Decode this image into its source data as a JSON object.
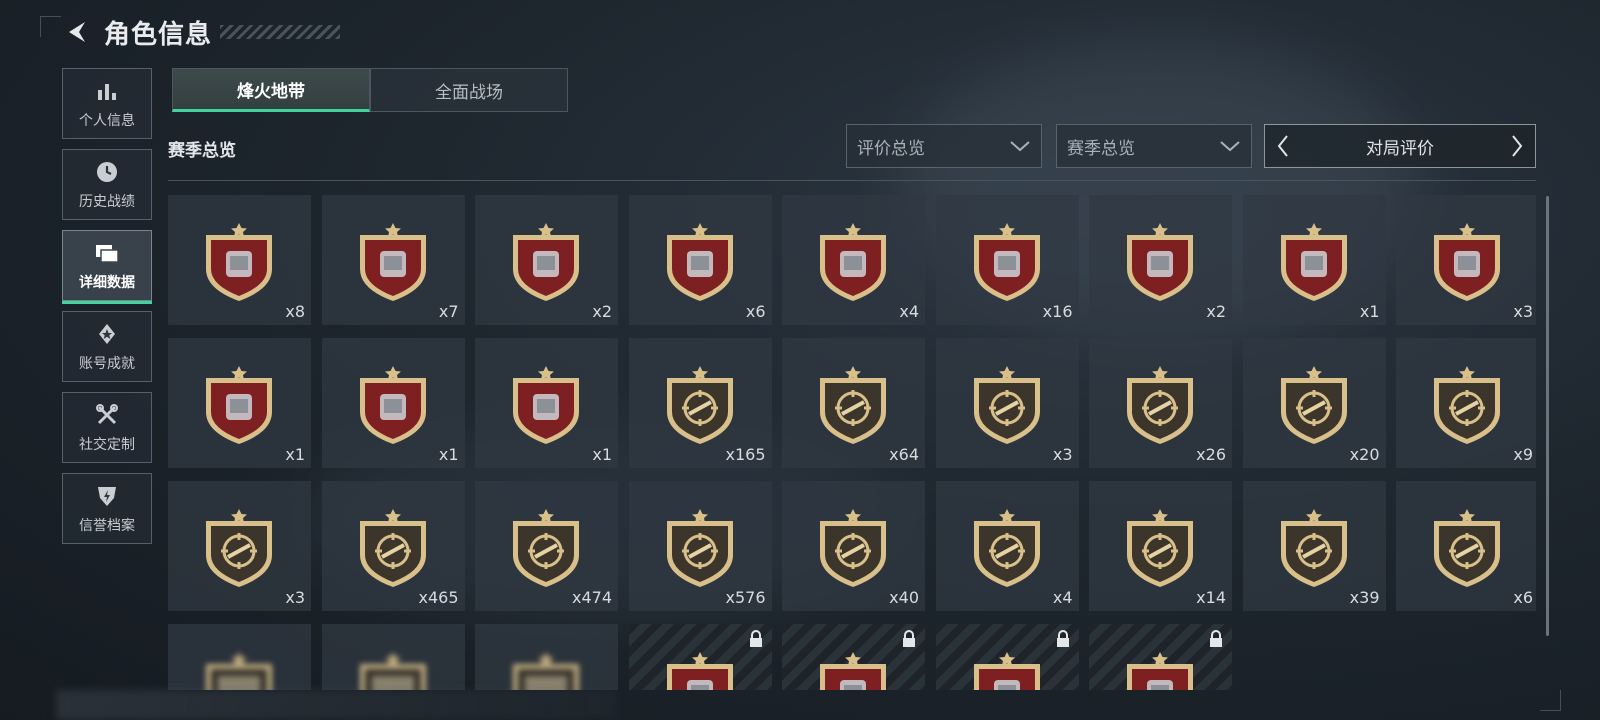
{
  "header": {
    "title": "角色信息",
    "back_icon": "back-arrow-icon"
  },
  "sidebar": {
    "items": [
      {
        "label": "个人信息",
        "icon": "bar-chart-icon",
        "active": false
      },
      {
        "label": "历史战绩",
        "icon": "clock-icon",
        "active": false
      },
      {
        "label": "详细数据",
        "icon": "folder-icon",
        "active": true
      },
      {
        "label": "账号成就",
        "icon": "medal-icon",
        "active": false
      },
      {
        "label": "社交定制",
        "icon": "tools-icon",
        "active": false
      },
      {
        "label": "信誉档案",
        "icon": "shield-bolt-icon",
        "active": false
      }
    ]
  },
  "tabs": [
    {
      "label": "烽火地带",
      "active": true
    },
    {
      "label": "全面战场",
      "active": false
    }
  ],
  "section": {
    "title": "赛季总览"
  },
  "filters": {
    "rating": {
      "label": "评价总览"
    },
    "season": {
      "label": "赛季总览"
    },
    "match": {
      "label": "对局评价"
    }
  },
  "colors": {
    "accent": "#43d39e",
    "gold": "#d9c08a",
    "red_shield": "#7e1f22"
  },
  "badges": [
    {
      "type": "red",
      "item": "diamond-icon",
      "count": "x8"
    },
    {
      "type": "red",
      "item": "tank-icon",
      "count": "x7"
    },
    {
      "type": "red",
      "item": "card-icon",
      "count": "x2"
    },
    {
      "type": "red",
      "item": "plate-icon",
      "count": "x6"
    },
    {
      "type": "red",
      "item": "server-rack-icon",
      "count": "x4"
    },
    {
      "type": "red",
      "item": "chip-icon",
      "count": "x16"
    },
    {
      "type": "red",
      "item": "machine-icon",
      "count": "x2"
    },
    {
      "type": "red",
      "item": "reactor-icon",
      "count": "x1"
    },
    {
      "type": "red",
      "item": "egg-icon",
      "count": "x3"
    },
    {
      "type": "red",
      "item": "chessboard-icon",
      "count": "x1"
    },
    {
      "type": "red",
      "item": "painting-icon",
      "count": "x1"
    },
    {
      "type": "red",
      "item": "crystal-icon",
      "count": "x1"
    },
    {
      "type": "gold",
      "item": "rifle-crosshair-icon",
      "count": "x165"
    },
    {
      "type": "gold",
      "item": "rifle-crosshair-icon",
      "count": "x64"
    },
    {
      "type": "gold",
      "item": "sniper-crosshair-icon",
      "count": "x3"
    },
    {
      "type": "gold",
      "item": "rifle-crosshair-icon",
      "count": "x26"
    },
    {
      "type": "gold",
      "item": "rifle-crosshair-icon",
      "count": "x20"
    },
    {
      "type": "gold",
      "item": "sniper-crosshair-icon",
      "count": "x9"
    },
    {
      "type": "gold",
      "item": "pistol-crosshair-icon",
      "count": "x3"
    },
    {
      "type": "gold",
      "item": "knife-crosshair-icon",
      "count": "x465"
    },
    {
      "type": "gold",
      "item": "explosion-icon",
      "count": "x474"
    },
    {
      "type": "gold",
      "item": "wreath-emblem-icon",
      "count": "x576"
    },
    {
      "type": "gold",
      "item": "wings-emblem-icon",
      "count": "x40"
    },
    {
      "type": "gold",
      "item": "soldier-head-icon",
      "count": "x4"
    },
    {
      "type": "gold",
      "item": "mask-head-icon",
      "count": "x14"
    },
    {
      "type": "gold",
      "item": "agent-head-icon",
      "count": "x39"
    },
    {
      "type": "gold",
      "item": "skull-head-icon",
      "count": "x6"
    },
    {
      "type": "gold-blur",
      "item": "blurred-icon",
      "count": ""
    },
    {
      "type": "gold-blur",
      "item": "blurred-icon",
      "count": ""
    },
    {
      "type": "gold-blur",
      "item": "blurred-icon",
      "count": ""
    },
    {
      "type": "locked",
      "item": "helmet-icon",
      "count": ""
    },
    {
      "type": "locked",
      "item": "map-icon",
      "count": ""
    },
    {
      "type": "locked",
      "item": "crate-icon",
      "count": ""
    },
    {
      "type": "locked",
      "item": "device-icon",
      "count": ""
    }
  ]
}
